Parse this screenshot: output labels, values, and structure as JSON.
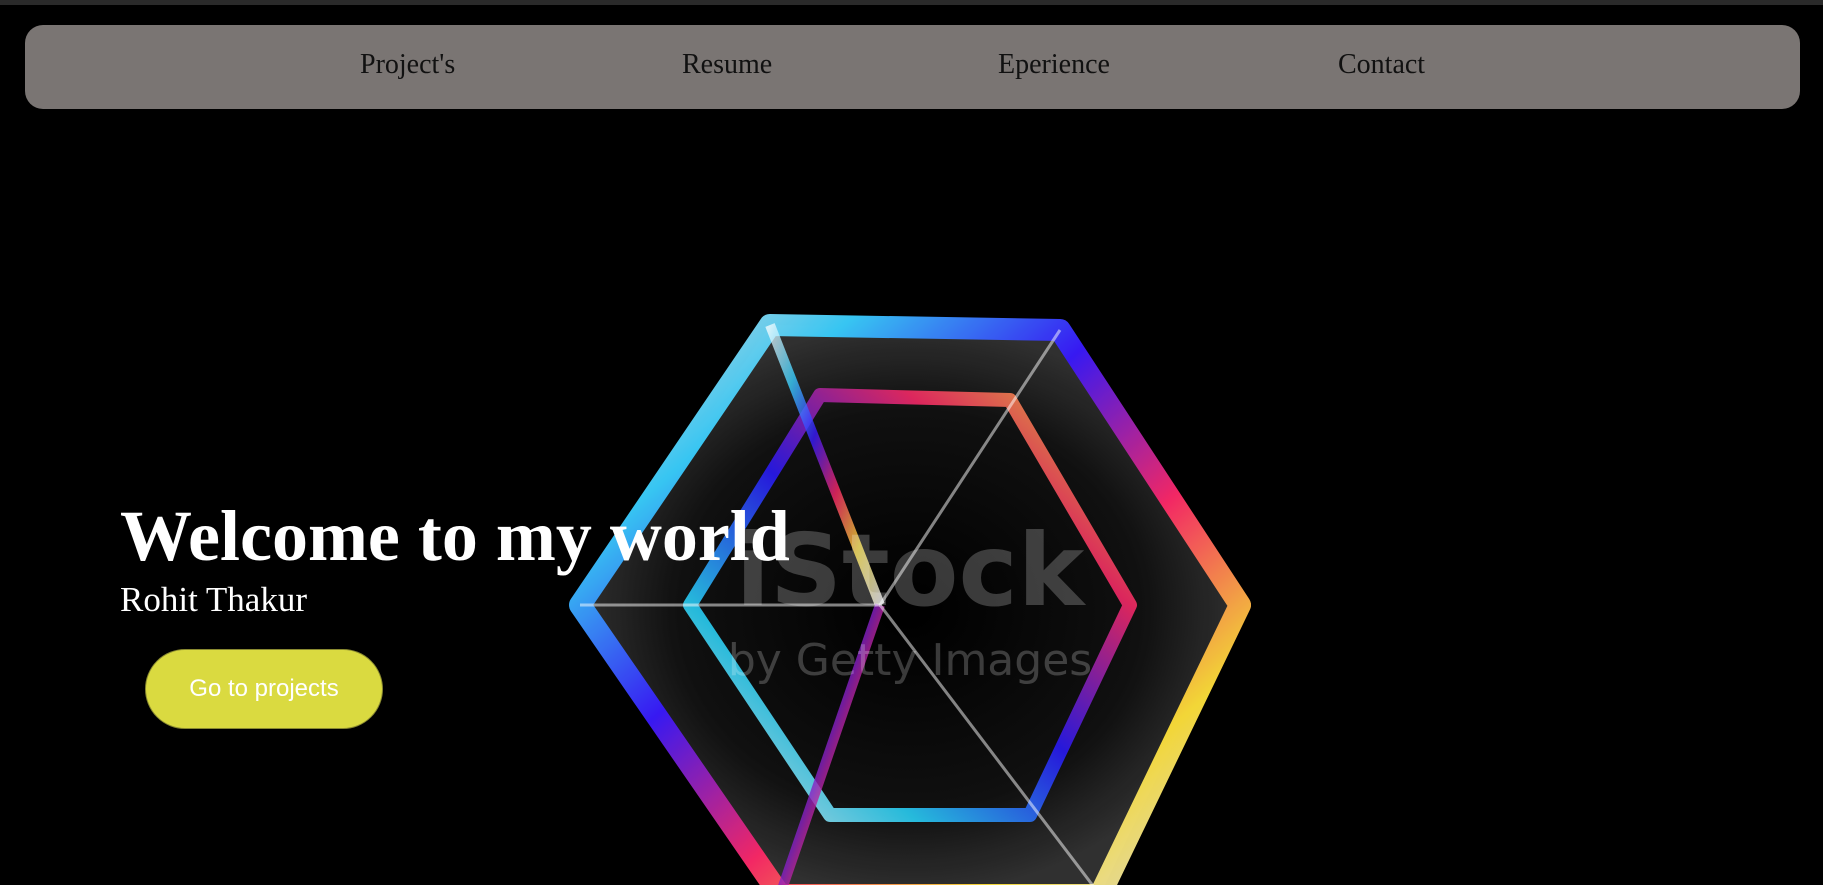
{
  "nav": {
    "items": [
      {
        "label": "Project's"
      },
      {
        "label": "Resume"
      },
      {
        "label": "Eperience"
      },
      {
        "label": "Contact"
      }
    ]
  },
  "hero": {
    "title": "Welcome to my world",
    "subtitle": "Rohit Thakur",
    "cta_label": "Go to projects",
    "media_watermark_main": "iStock",
    "media_watermark_sub": "by Getty Images",
    "media_icon": "prismatic-glass-cube-image"
  },
  "colors": {
    "background": "#000000",
    "navbar": "#7a7573",
    "cta": "#dada40",
    "text_light": "#ffffff",
    "text_dark": "#111111"
  }
}
